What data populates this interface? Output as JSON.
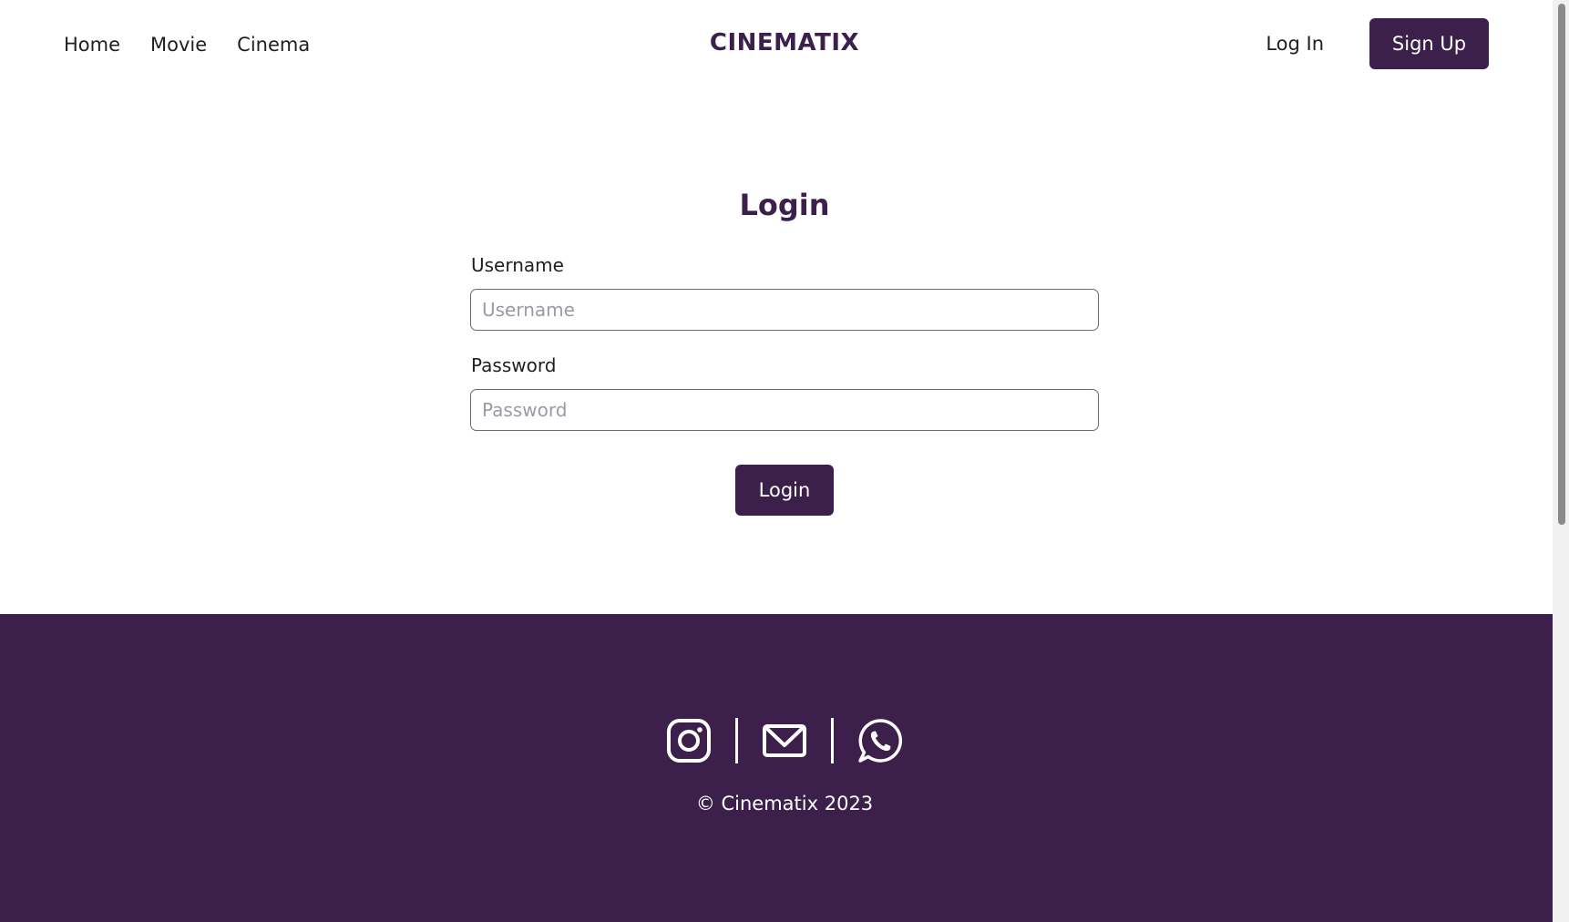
{
  "nav": {
    "links": [
      "Home",
      "Movie",
      "Cinema"
    ],
    "brand": "CINEMATIX",
    "login_label": "Log In",
    "signup_label": "Sign Up"
  },
  "form": {
    "title": "Login",
    "username_label": "Username",
    "username_placeholder": "Username",
    "username_value": "",
    "password_label": "Password",
    "password_placeholder": "Password",
    "password_value": "",
    "submit_label": "Login"
  },
  "footer": {
    "icons": [
      "instagram-icon",
      "mail-icon",
      "whatsapp-icon"
    ],
    "copyright": "© Cinematix 2023"
  },
  "colors": {
    "brand": "#3c1f4b",
    "text": "#1f1f1f",
    "footer_text": "#ffffff"
  }
}
